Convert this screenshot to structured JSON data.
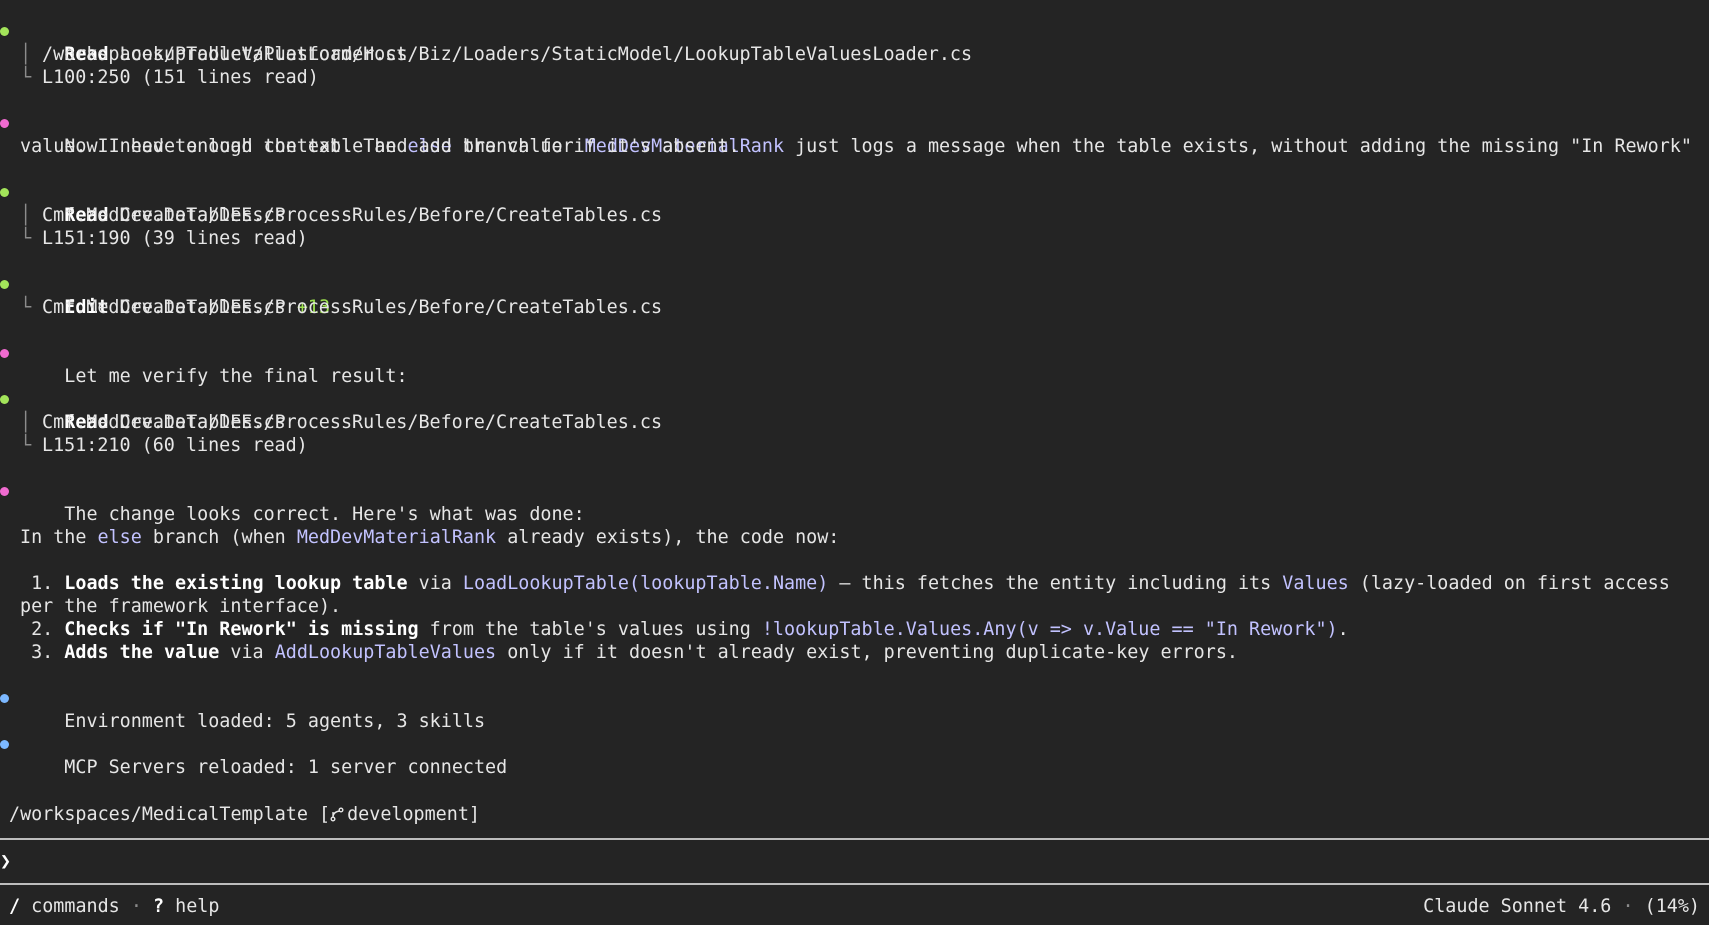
{
  "colors": {
    "background": "#242424",
    "tool_dot": "#a3e45a",
    "assistant_dot": "#f06bd0",
    "system_dot": "#7cb8ff",
    "code": "#c2c2ff",
    "diff_added": "#9de24f"
  },
  "entries": {
    "read1": {
      "action": "Read",
      "file": "LookupTableValuesLoader.cs",
      "path": "/workspaces/Product/Platform/Host/Biz/Loaders/StaticModel/LookupTableValuesLoader.cs",
      "range": "L100:250 (151 lines read)"
    },
    "msg1": {
      "p1": "Now I have enough context. The ",
      "c1": "else",
      "p2": " branch for ",
      "c2": "MedDevMaterialRank",
      "p3": " just logs a message when the table exists, without adding the missing \"In Rework\"",
      "line2": "value. I need to load the table and add the value if it's absent."
    },
    "read2": {
      "action": "Read",
      "file": "CreateTables.cs",
      "path": "Cmf.MedDev.Data/DEEs/ProcessRules/Before/CreateTables.cs",
      "range": "L151:190 (39 lines read)"
    },
    "edit1": {
      "action": "Edit",
      "file": "CreateTables.cs",
      "diff": "+13",
      "path": "Cmf.MedDev.Data/DEEs/ProcessRules/Before/CreateTables.cs"
    },
    "msg2": {
      "text": "Let me verify the final result:"
    },
    "read3": {
      "action": "Read",
      "file": "CreateTables.cs",
      "path": "Cmf.MedDev.Data/DEEs/ProcessRules/Before/CreateTables.cs",
      "range": "L151:210 (60 lines read)"
    },
    "msg3": {
      "intro": "The change looks correct. Here's what was done:",
      "p1": "In the ",
      "c1": "else",
      "p2": " branch (when ",
      "c2": "MedDevMaterialRank",
      "p3": " already exists), the code now:",
      "items": [
        {
          "num": " 1. ",
          "bold": "Loads the existing lookup table",
          "t1": " via ",
          "code1": "LoadLookupTable(lookupTable.Name)",
          "t2": " — this fetches the entity including its ",
          "code2": "Values",
          "t3": " (lazy-loaded on first access",
          "cont": "per the framework interface)."
        },
        {
          "num": " 2. ",
          "bold": "Checks if \"In Rework\" is missing",
          "t1": " from the table's values using ",
          "code1": "!lookupTable.Values.Any(v => v.Value == \"In Rework\")",
          "t2": "."
        },
        {
          "num": " 3. ",
          "bold": "Adds the value",
          "t1": " via ",
          "code1": "AddLookupTableValues",
          "t2": " only if it doesn't already exist, preventing duplicate-key errors."
        }
      ]
    },
    "sys1": {
      "text": "Environment loaded: 5 agents, 3 skills"
    },
    "sys2": {
      "text": "MCP Servers reloaded: 1 server connected"
    }
  },
  "cwd": {
    "path": "/workspaces/MedicalTemplate",
    "open": " [",
    "branch_icon": "git-branch-icon",
    "branch": "development",
    "close": "]"
  },
  "prompt": {
    "symbol": "❯",
    "value": ""
  },
  "footer": {
    "commands_key": "/",
    "commands_label": "commands",
    "separator": "·",
    "help_key": "?",
    "help_label": "help",
    "model": "Claude Sonnet 4.6",
    "context": "(14%)"
  }
}
